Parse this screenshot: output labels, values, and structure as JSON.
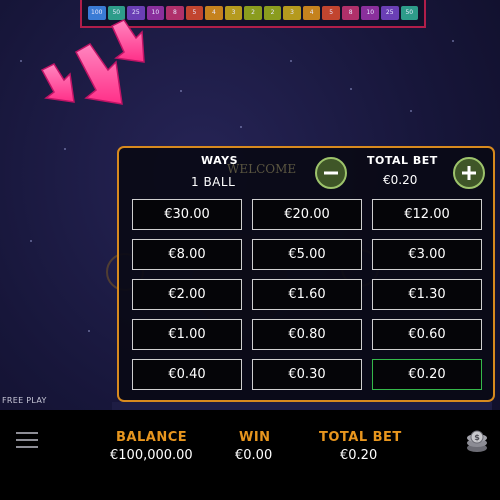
{
  "multiplier_strip": [
    "100",
    "50",
    "25",
    "10",
    "8",
    "5",
    "4",
    "3",
    "2",
    "2",
    "3",
    "4",
    "5",
    "8",
    "10",
    "25",
    "50"
  ],
  "colors": {
    "accent": "#d88a1e",
    "label": "#e8961e",
    "selected": "#35b84a",
    "button": "#3f5628",
    "arrow": "#ff4f9a"
  },
  "bet_panel": {
    "ways_label": "WAYS",
    "ways_value": "1 BALL",
    "welcome_text": "WELCOME",
    "total_bet_label": "TOTAL BET",
    "total_bet_value": "€0.20",
    "minus_icon": "minus-icon",
    "plus_icon": "plus-icon",
    "options": [
      "€30.00",
      "€20.00",
      "€12.00",
      "€8.00",
      "€5.00",
      "€3.00",
      "€2.00",
      "€1.60",
      "€1.30",
      "€1.00",
      "€0.80",
      "€0.60",
      "€0.40",
      "€0.30",
      "€0.20"
    ],
    "selected_value": "€0.20"
  },
  "free_play": "FREE PLAY",
  "bottom_bar": {
    "menu_icon": "hamburger-menu-icon",
    "balance_label": "BALANCE",
    "balance_value": "€100,000.00",
    "win_label": "WIN",
    "win_value": "€0.00",
    "total_bet_label": "TOTAL BET",
    "total_bet_value": "€0.20",
    "coins_icon": "coin-stack-icon"
  }
}
